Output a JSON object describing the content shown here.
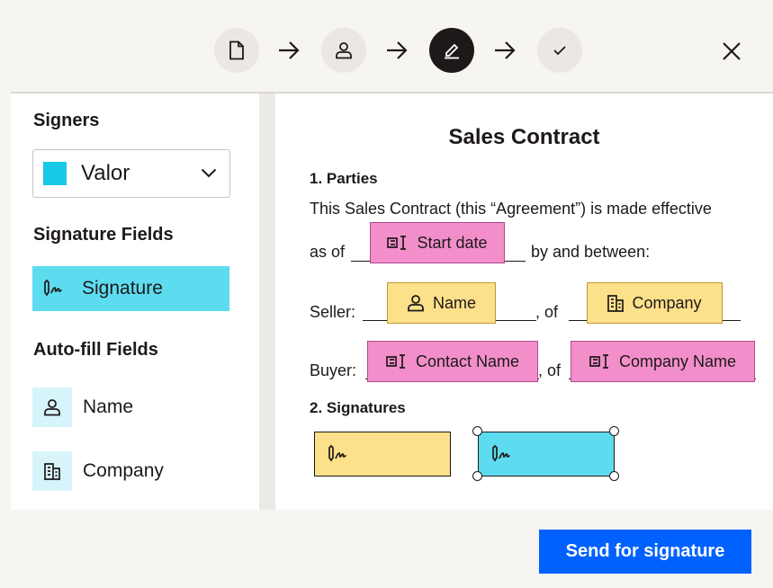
{
  "stepper": {
    "steps": [
      {
        "icon": "document-icon",
        "state": "done"
      },
      {
        "icon": "person-icon",
        "state": "done"
      },
      {
        "icon": "pen-icon",
        "state": "active"
      },
      {
        "icon": "check-icon",
        "state": "upcoming"
      }
    ],
    "close_icon": "close-icon"
  },
  "sidebar": {
    "signers_heading": "Signers",
    "selected_signer": "Valor",
    "signer_color": "#19c9e8",
    "signature_fields_heading": "Signature Fields",
    "signature_field_label": "Signature",
    "autofill_heading": "Auto-fill Fields",
    "autofill_items": [
      {
        "label": "Name",
        "icon": "person-icon"
      },
      {
        "label": "Company",
        "icon": "building-icon"
      }
    ]
  },
  "document": {
    "title": "Sales Contract",
    "section1": "1. Parties",
    "intro": "This Sales Contract (this “Agreement”) is made effective",
    "as_of": "as of",
    "by_and_between": "by and between:",
    "seller_label": "Seller:",
    "buyer_label": "Buyer:",
    "of_label": ", of",
    "fields": {
      "start_date": "Start date",
      "seller_name": "Name",
      "seller_company": "Company",
      "buyer_contact": "Contact Name",
      "buyer_company": "Company Name"
    },
    "section2": "2. Signatures"
  },
  "colors": {
    "autofill_field": "#f28fcb",
    "seller_field": "#fde08a",
    "signer_field": "#5ddcf0",
    "primary_button": "#0061fe"
  },
  "footer": {
    "send_button": "Send for signature"
  }
}
